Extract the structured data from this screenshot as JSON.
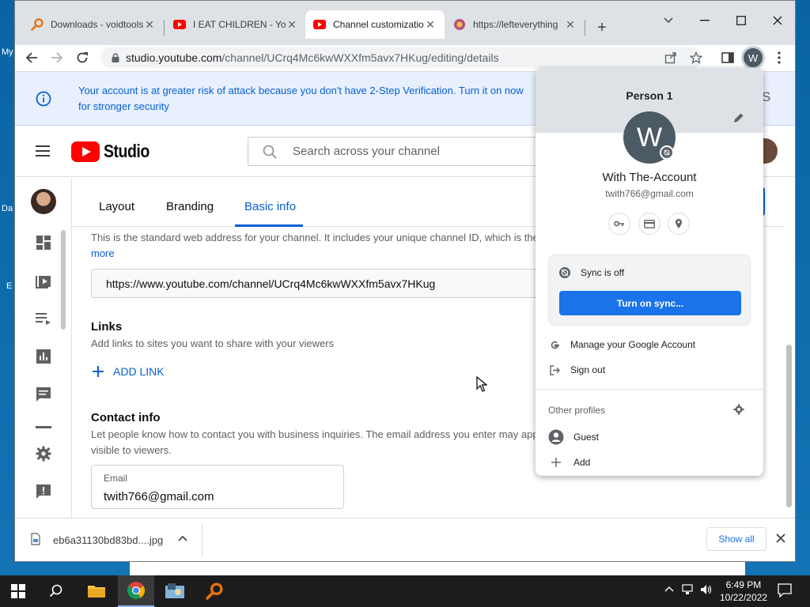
{
  "desktop": {
    "label1": "My",
    "label2": "Da",
    "label3": "E"
  },
  "tabs": [
    {
      "title": "Downloads - voidtools"
    },
    {
      "title": "I EAT CHILDREN - YouTube"
    },
    {
      "title": "Channel customization"
    },
    {
      "title": "https://lefteverything"
    }
  ],
  "omnibox": {
    "host": "studio.youtube.com",
    "path": "/channel/UCrq4Mc6kwWXXfm5avx7HKug/editing/details"
  },
  "profile_button": {
    "letter": "W"
  },
  "banner": {
    "text": "Your account is at greater risk of attack because you don't have 2-Step Verification. Turn it on now for stronger security",
    "dismiss": "S"
  },
  "studio": {
    "logo_text": "Studio",
    "search_placeholder": "Search across your channel",
    "tabs": {
      "layout": "Layout",
      "branding": "Branding",
      "basic": "Basic info"
    },
    "url_desc": "This is the standard web address for your channel. It includes your unique channel ID, which is the",
    "more": "more",
    "channel_url": "https://www.youtube.com/channel/UCrq4Mc6kwWXXfm5avx7HKug",
    "links_title": "Links",
    "links_desc": "Add links to sites you want to share with your viewers",
    "add_link": "ADD LINK",
    "contact_title": "Contact info",
    "contact_desc_1": "Let people know how to contact you with business inquiries. The email address you enter may appear",
    "contact_desc_2": "visible to viewers.",
    "email_label": "Email",
    "email_value": "twith766@gmail.com"
  },
  "download": {
    "filename": "eb6a31130bd83bd....jpg",
    "show_all": "Show all"
  },
  "popup": {
    "person": "Person 1",
    "avatar_letter": "W",
    "display_name": "With The-Account",
    "email": "twith766@gmail.com",
    "sync_status": "Sync is off",
    "sync_button": "Turn on sync...",
    "manage": "Manage your Google Account",
    "sign_out": "Sign out",
    "other_profiles": "Other profiles",
    "guest": "Guest",
    "add": "Add"
  },
  "taskbar": {
    "time": "6:49 PM",
    "date": "10/22/2022"
  },
  "colors": {
    "accent": "#1a73e8",
    "yt_red": "#ff0000",
    "studio_blue": "#065fd4"
  }
}
